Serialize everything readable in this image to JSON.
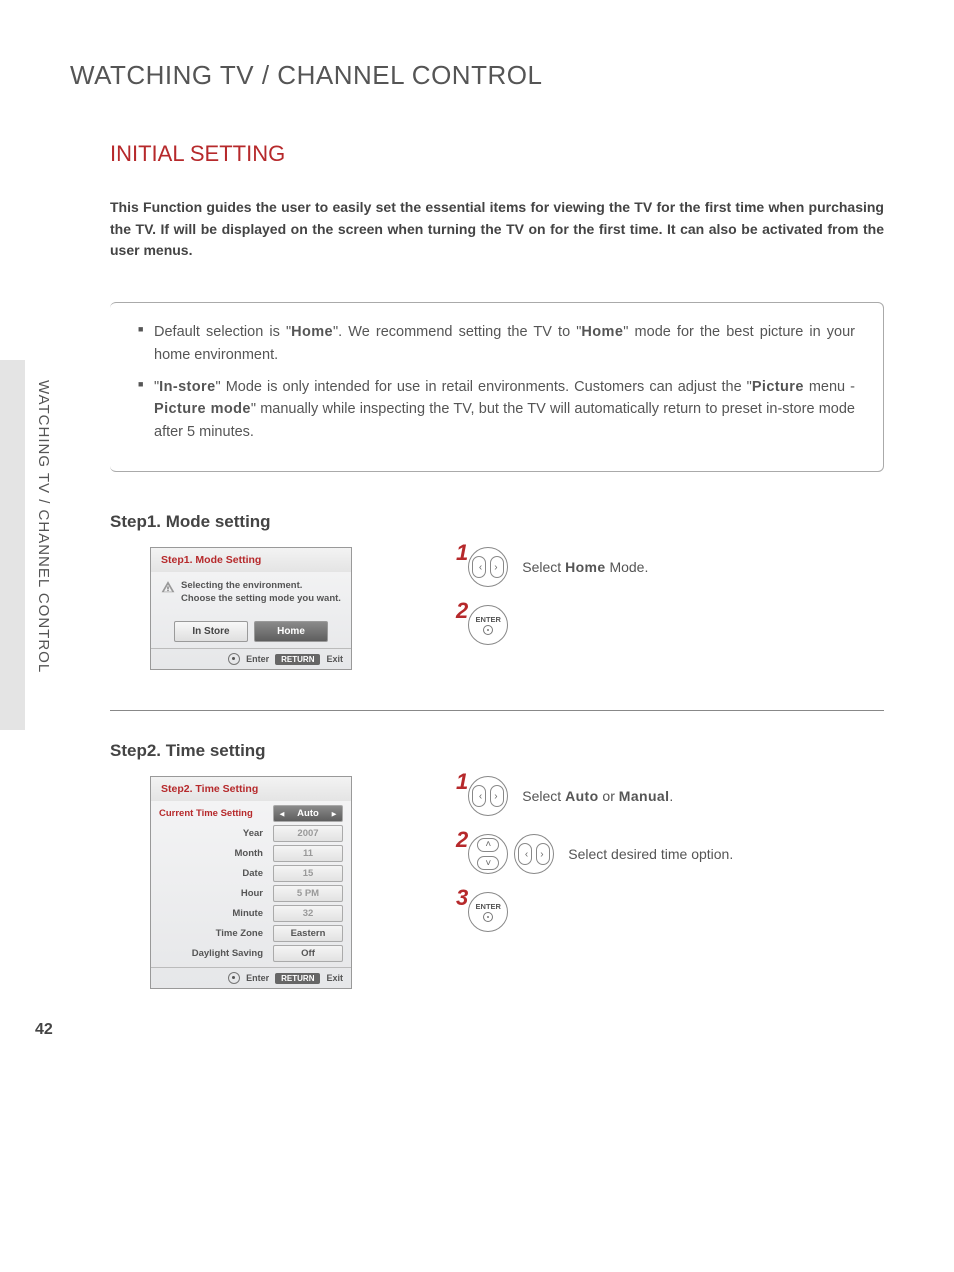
{
  "page_number": "42",
  "side_label": "WATCHING TV / CHANNEL CONTROL",
  "title": "WATCHING TV / CHANNEL CONTROL",
  "section": "INITIAL SETTING",
  "intro": "This Function guides the user to easily set the essential items for viewing the TV for the first time when purchasing the TV. If will be displayed on the screen when turning the TV on for the first time. It can also be activated from the user menus.",
  "notes": {
    "n1a": "Default selection is \"",
    "n1b": "Home",
    "n1c": "\". We recommend setting the TV to \"",
    "n1d": "Home",
    "n1e": "\" mode for the best picture in your home environment.",
    "n2a": "\"",
    "n2b": "In-store",
    "n2c": "\" Mode is only intended for use in retail environments. Customers can adjust the \"",
    "n2d": "Picture",
    "n2e": " menu - ",
    "n2f": "Picture mode",
    "n2g": "\" manually while inspecting the TV, but the TV will automatically return to preset in-store mode after 5 minutes."
  },
  "step1": {
    "heading": "Step1. Mode setting",
    "osd_title": "Step1. Mode Setting",
    "msg1": "Selecting the environment.",
    "msg2": "Choose the setting mode you want.",
    "btn_instore": "In Store",
    "btn_home": "Home",
    "foot_enter": "Enter",
    "foot_return": "RETURN",
    "foot_exit": "Exit",
    "instr_num1": "1",
    "instr_text1a": "Select ",
    "instr_text1b": "Home",
    "instr_text1c": " Mode.",
    "instr_num2": "2",
    "enter_label": "ENTER"
  },
  "step2": {
    "heading": "Step2. Time setting",
    "osd_title": "Step2. Time Setting",
    "header_label": "Current Time Setting",
    "rows": [
      {
        "label": "",
        "value": "Auto",
        "active": true
      },
      {
        "label": "Year",
        "value": "2007"
      },
      {
        "label": "Month",
        "value": "11"
      },
      {
        "label": "Date",
        "value": "15"
      },
      {
        "label": "Hour",
        "value": "5 PM"
      },
      {
        "label": "Minute",
        "value": "32"
      },
      {
        "label": "Time Zone",
        "value": "Eastern",
        "enabled": true
      },
      {
        "label": "Daylight Saving",
        "value": "Off",
        "enabled": true
      }
    ],
    "foot_enter": "Enter",
    "foot_return": "RETURN",
    "foot_exit": "Exit",
    "instr_num1": "1",
    "instr_text1a": "Select ",
    "instr_text1b": "Auto",
    "instr_text1c": " or ",
    "instr_text1d": "Manual",
    "instr_text1e": ".",
    "instr_num2": "2",
    "instr_text2": "Select desired time option.",
    "instr_num3": "3",
    "enter_label": "ENTER"
  }
}
